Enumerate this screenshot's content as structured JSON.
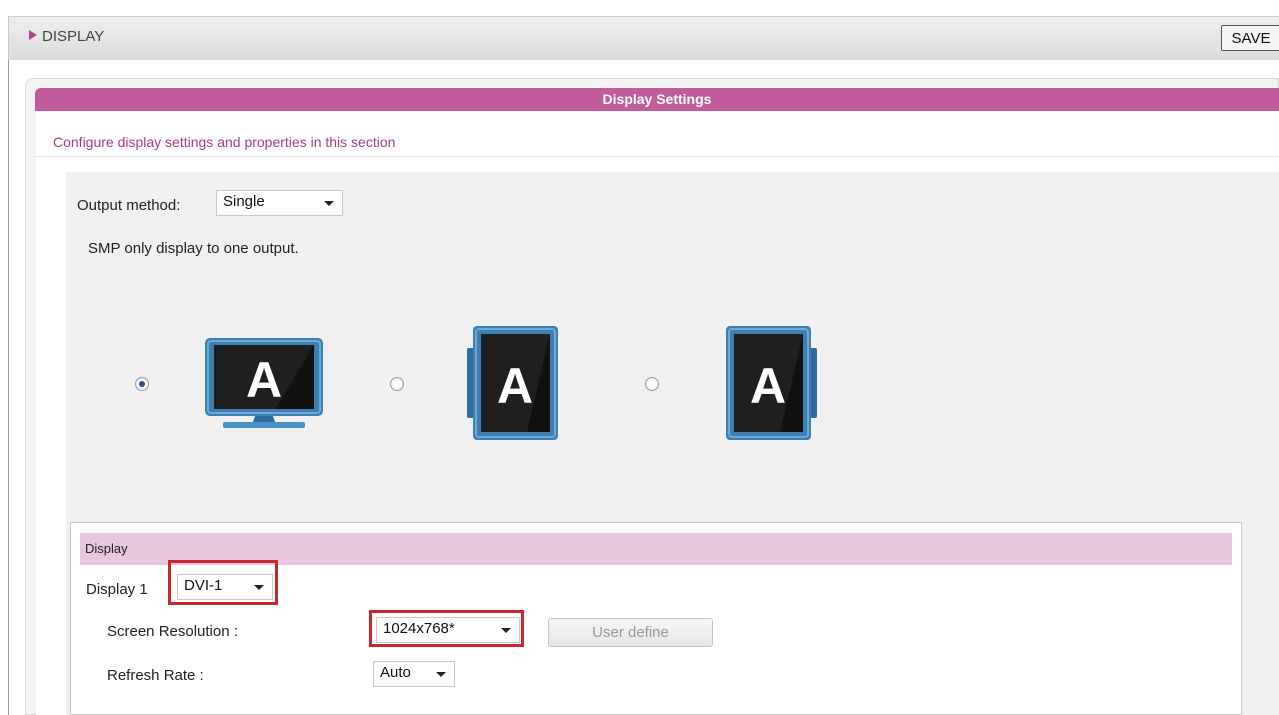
{
  "header": {
    "title": "DISPLAY",
    "save_label": "SAVE"
  },
  "panel": {
    "title": "Display Settings",
    "description": "Configure display settings and properties in this section"
  },
  "output": {
    "label": "Output method:",
    "value": "Single",
    "note": "SMP only display to one output.",
    "options": [
      {
        "icon": "single-monitor-icon",
        "glyph": "A",
        "selected": true
      },
      {
        "icon": "portrait-left-monitor-icon",
        "glyph": "A",
        "selected": false
      },
      {
        "icon": "portrait-right-monitor-icon",
        "glyph": "A",
        "selected": false
      }
    ]
  },
  "display": {
    "section_title": "Display",
    "display1_label": "Display 1",
    "display1_value": "DVI-1",
    "resolution_label": "Screen Resolution :",
    "resolution_value": "1024x768*",
    "user_define_label": "User define",
    "refresh_label": "Refresh Rate :",
    "refresh_value": "Auto"
  },
  "colors": {
    "accent": "#c15c9c",
    "section_bg": "#e9c6dd",
    "highlight": "#c8272d",
    "monitor_frame": "#3b7fb3"
  }
}
